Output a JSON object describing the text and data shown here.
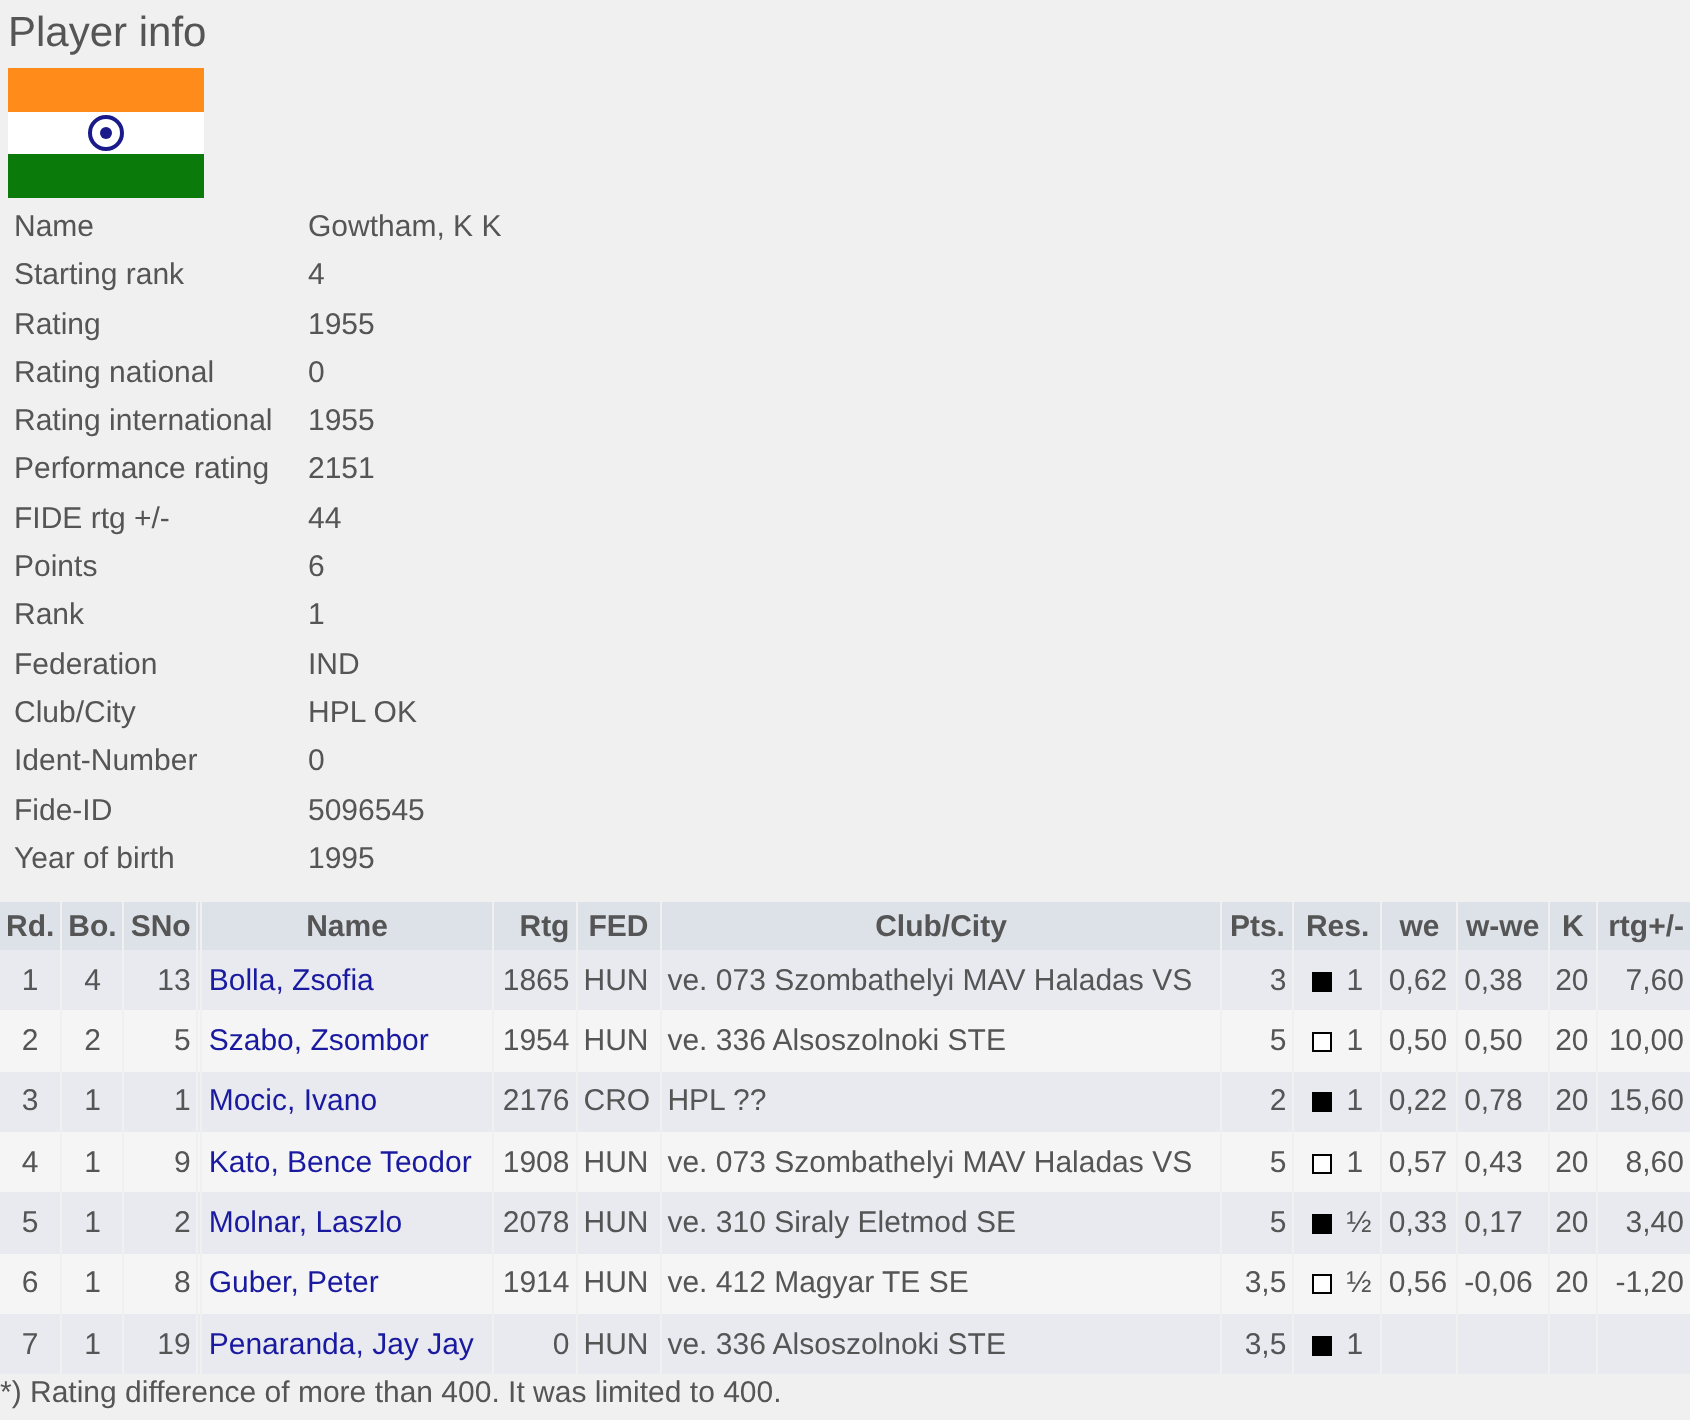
{
  "title": "Player info",
  "info": [
    {
      "label": "Name",
      "value": "Gowtham, K K"
    },
    {
      "label": "Starting rank",
      "value": "4"
    },
    {
      "label": "Rating",
      "value": "1955"
    },
    {
      "label": "Rating national",
      "value": "0"
    },
    {
      "label": "Rating international",
      "value": "1955"
    },
    {
      "label": "Performance rating",
      "value": "2151"
    },
    {
      "label": "FIDE rtg +/-",
      "value": "44"
    },
    {
      "label": "Points",
      "value": "6"
    },
    {
      "label": "Rank",
      "value": "1"
    },
    {
      "label": "Federation",
      "value": "IND"
    },
    {
      "label": "Club/City",
      "value": "HPL OK"
    },
    {
      "label": "Ident-Number",
      "value": "0"
    },
    {
      "label": "Fide-ID",
      "value": "5096545"
    },
    {
      "label": "Year of birth",
      "value": "1995"
    }
  ],
  "table": {
    "columns": [
      "Rd.",
      "Bo.",
      "SNo",
      "Name",
      "Rtg",
      "FED",
      "Club/City",
      "Pts.",
      "Res.",
      "we",
      "w-we",
      "K",
      "rtg+/-"
    ],
    "rows": [
      {
        "rd": "1",
        "bo": "4",
        "sno": "13",
        "name": "Bolla, Zsofia",
        "rtg": "1865",
        "fed": "HUN",
        "club": "ve. 073 Szombathelyi MAV Haladas VS",
        "pts": "3",
        "color": "#000000",
        "res": "1",
        "we": "0,62",
        "wwe": "0,38",
        "k": "20",
        "diff": "7,60"
      },
      {
        "rd": "2",
        "bo": "2",
        "sno": "5",
        "name": "Szabo, Zsombor",
        "rtg": "1954",
        "fed": "HUN",
        "club": "ve. 336 Alsoszolnoki STE",
        "pts": "5",
        "color": "#ffffff",
        "res": "1",
        "we": "0,50",
        "wwe": "0,50",
        "k": "20",
        "diff": "10,00"
      },
      {
        "rd": "3",
        "bo": "1",
        "sno": "1",
        "name": "Mocic, Ivano",
        "rtg": "2176",
        "fed": "CRO",
        "club": "HPL ??",
        "pts": "2",
        "color": "#000000",
        "res": "1",
        "we": "0,22",
        "wwe": "0,78",
        "k": "20",
        "diff": "15,60"
      },
      {
        "rd": "4",
        "bo": "1",
        "sno": "9",
        "name": "Kato, Bence Teodor",
        "rtg": "1908",
        "fed": "HUN",
        "club": "ve. 073 Szombathelyi MAV Haladas VS",
        "pts": "5",
        "color": "#ffffff",
        "res": "1",
        "we": "0,57",
        "wwe": "0,43",
        "k": "20",
        "diff": "8,60"
      },
      {
        "rd": "5",
        "bo": "1",
        "sno": "2",
        "name": "Molnar, Laszlo",
        "rtg": "2078",
        "fed": "HUN",
        "club": "ve. 310 Siraly Eletmod SE",
        "pts": "5",
        "color": "#000000",
        "res": "½",
        "we": "0,33",
        "wwe": "0,17",
        "k": "20",
        "diff": "3,40"
      },
      {
        "rd": "6",
        "bo": "1",
        "sno": "8",
        "name": "Guber, Peter",
        "rtg": "1914",
        "fed": "HUN",
        "club": "ve. 412 Magyar TE SE",
        "pts": "3,5",
        "color": "#ffffff",
        "res": "½",
        "we": "0,56",
        "wwe": "-0,06",
        "k": "20",
        "diff": "-1,20"
      },
      {
        "rd": "7",
        "bo": "1",
        "sno": "19",
        "name": "Penaranda, Jay Jay",
        "rtg": "0",
        "fed": "HUN",
        "club": "ve. 336 Alsoszolnoki STE",
        "pts": "3,5",
        "color": "#000000",
        "res": "1"
      }
    ]
  },
  "footnote": "*) Rating difference of more than 400. It was limited to 400."
}
